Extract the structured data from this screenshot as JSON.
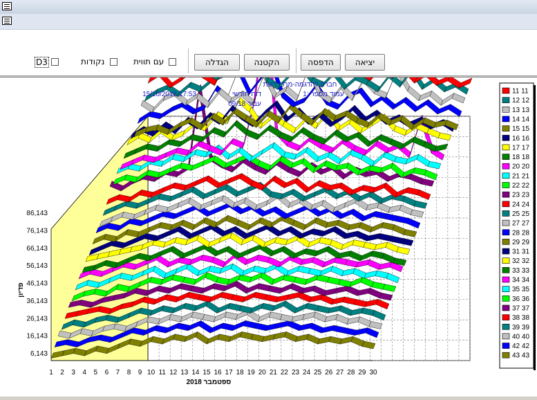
{
  "toolbar": {
    "exit_label": "יציאה",
    "print_label": "הדפסה",
    "shrink_label": "הקטנה",
    "zoom_label": "הגדלה",
    "d3_label": "D3",
    "points_label": "נקודות",
    "area_label": "עם תווית"
  },
  "header": {
    "company": "חברה להדגמה-מרכז רשת",
    "report": "דוח חודשי",
    "page": "עמוד מספר :1",
    "datetime": "15/10/2018 17:53",
    "period": "עבור  09/18"
  },
  "colors": {
    "wall": "#ffff99",
    "grid": "#808080",
    "axis_text": "#000000",
    "header_text": "#1f1fc8"
  },
  "chart_data": {
    "type": "line",
    "style": "3d-ribbon",
    "xlabel": "ספטמבר 2018",
    "ylabel": "פדיון",
    "x": [
      "1",
      "2",
      "3",
      "4",
      "5",
      "6",
      "7",
      "8",
      "9",
      "10",
      "11",
      "12",
      "13",
      "14",
      "15",
      "16",
      "17",
      "18",
      "19",
      "20",
      "21",
      "22",
      "23",
      "24",
      "25",
      "26",
      "27",
      "28",
      "29",
      "30"
    ],
    "y_ticks": [
      "6,143",
      "16,143",
      "26,143",
      "36,143",
      "46,143",
      "56,143",
      "66,143",
      "76,143",
      "86,143"
    ],
    "ylim": [
      6143,
      86143
    ],
    "legend_position": "right",
    "series": [
      {
        "name": "11 11",
        "color": "#ff0000",
        "values": [
          14000,
          17000,
          12000,
          15000,
          19000,
          16000,
          13000,
          22000,
          18000,
          24000,
          21000,
          17000,
          26000,
          30000,
          27000,
          23000,
          19000,
          17000,
          22000,
          18000,
          15000,
          20000,
          16000,
          19000,
          14000,
          17000,
          13000,
          15000,
          12000,
          14000
        ]
      },
      {
        "name": "12 12",
        "color": "#008080",
        "values": [
          10000,
          13000,
          15000,
          12000,
          16000,
          14000,
          18000,
          20000,
          60000,
          79000,
          33000,
          18000,
          15000,
          20000,
          24000,
          18000,
          16000,
          21000,
          15000,
          19000,
          17000,
          14000,
          20000,
          16000,
          22000,
          15000,
          18000,
          14000,
          16000,
          13000
        ]
      },
      {
        "name": "13 13",
        "color": "#c0c0c0",
        "values": [
          12000,
          9000,
          14000,
          16000,
          12000,
          15000,
          11000,
          17000,
          13000,
          16000,
          12000,
          24000,
          15000,
          18000,
          14000,
          27000,
          16000,
          13000,
          19000,
          14000,
          22000,
          17000,
          15000,
          26000,
          18000,
          14000,
          16000,
          12000,
          15000,
          13000
        ]
      },
      {
        "name": "14 14",
        "color": "#0000ff",
        "values": [
          8000,
          11000,
          10000,
          13000,
          15000,
          12000,
          14000,
          22000,
          18000,
          30000,
          20000,
          26000,
          32000,
          19000,
          15000,
          17000,
          23000,
          16000,
          14000,
          19000,
          21000,
          15000,
          18000,
          14000,
          17000,
          13000,
          16000,
          12000,
          14000,
          11000
        ]
      },
      {
        "name": "15 15",
        "color": "#808000",
        "values": [
          6000,
          8000,
          9000,
          7000,
          10000,
          12000,
          9000,
          14000,
          11000,
          16000,
          13000,
          10000,
          15000,
          12000,
          18000,
          14000,
          11000,
          16000,
          13000,
          15000,
          12000,
          10000,
          14000,
          11000,
          13000,
          9000,
          12000,
          10000,
          11000,
          9000
        ]
      },
      {
        "name": "16 16",
        "color": "#000080",
        "values": [
          9000,
          12000,
          10000,
          14000,
          11000,
          16000,
          13000,
          18000,
          15000,
          21000,
          17000,
          14000,
          19000,
          23000,
          16000,
          20000,
          15000,
          18000,
          14000,
          17000,
          21000,
          16000,
          19000,
          15000,
          17000,
          14000,
          16000,
          13000,
          15000,
          12000
        ]
      },
      {
        "name": "17 17",
        "color": "#ffff00",
        "values": [
          10000,
          13000,
          11000,
          15000,
          12000,
          14000,
          18000,
          16000,
          22000,
          19000,
          28000,
          24000,
          17000,
          21000,
          18000,
          15000,
          20000,
          17000,
          23000,
          16000,
          19000,
          15000,
          18000,
          21000,
          16000,
          14000,
          17000,
          15000,
          13000,
          12000
        ]
      },
      {
        "name": "18 18",
        "color": "#008000",
        "values": [
          8000,
          10000,
          12000,
          11000,
          14000,
          13000,
          16000,
          15000,
          19000,
          17000,
          22000,
          18000,
          16000,
          20000,
          17000,
          15000,
          19000,
          16000,
          14000,
          18000,
          15000,
          17000,
          13000,
          16000,
          14000,
          12000,
          15000,
          13000,
          11000,
          12000
        ]
      },
      {
        "name": "20 20",
        "color": "#ff00ff",
        "values": [
          7000,
          9000,
          11000,
          10000,
          12000,
          14000,
          13000,
          17000,
          15000,
          13000,
          18000,
          16000,
          35000,
          74000,
          22000,
          17000,
          15000,
          19000,
          16000,
          14000,
          18000,
          15000,
          13000,
          17000,
          14000,
          16000,
          12000,
          28000,
          14000,
          11000
        ]
      },
      {
        "name": "21 21",
        "color": "#00ffff",
        "values": [
          9000,
          11000,
          10000,
          13000,
          12000,
          15000,
          14000,
          17000,
          16000,
          19000,
          15000,
          18000,
          14000,
          17000,
          20000,
          16000,
          15000,
          18000,
          14000,
          16000,
          13000,
          17000,
          15000,
          12000,
          16000,
          14000,
          13000,
          15000,
          12000,
          11000
        ]
      },
      {
        "name": "22 22",
        "color": "#00ff00",
        "values": [
          8000,
          10000,
          9000,
          12000,
          11000,
          13000,
          15000,
          14000,
          16000,
          18000,
          15000,
          17000,
          19000,
          16000,
          14000,
          18000,
          15000,
          17000,
          13000,
          16000,
          14000,
          15000,
          12000,
          14000,
          13000,
          15000,
          11000,
          13000,
          12000,
          10000
        ]
      },
      {
        "name": "23 23",
        "color": "#800080",
        "values": [
          11000,
          9000,
          12000,
          14000,
          13000,
          16000,
          15000,
          18000,
          52000,
          22000,
          19000,
          17000,
          21000,
          18000,
          16000,
          20000,
          17000,
          15000,
          19000,
          16000,
          18000,
          14000,
          17000,
          15000,
          16000,
          13000,
          15000,
          14000,
          12000,
          11000
        ]
      },
      {
        "name": "24 24",
        "color": "#ff0000",
        "values": [
          7000,
          9000,
          8000,
          11000,
          10000,
          12000,
          14000,
          13000,
          15000,
          17000,
          14000,
          16000,
          18000,
          15000,
          13000,
          17000,
          14000,
          16000,
          12000,
          15000,
          13000,
          14000,
          11000,
          13000,
          12000,
          14000,
          10000,
          12000,
          11000,
          9000
        ]
      },
      {
        "name": "25 25",
        "color": "#008080",
        "values": [
          6000,
          8000,
          10000,
          9000,
          11000,
          13000,
          12000,
          14000,
          16000,
          13000,
          15000,
          17000,
          14000,
          16000,
          18000,
          14000,
          13000,
          15000,
          12000,
          14000,
          16000,
          13000,
          15000,
          12000,
          14000,
          11000,
          13000,
          12000,
          10000,
          9000
        ]
      },
      {
        "name": "27 27",
        "color": "#c0c0c0",
        "values": [
          5000,
          7000,
          9000,
          8000,
          10000,
          12000,
          11000,
          13000,
          15000,
          12000,
          14000,
          16000,
          13000,
          15000,
          12000,
          14000,
          17000,
          13000,
          15000,
          12000,
          14000,
          11000,
          13000,
          15000,
          12000,
          13000,
          11000,
          12000,
          10000,
          9000
        ]
      },
      {
        "name": "28 28",
        "color": "#0000ff",
        "values": [
          6000,
          8000,
          7000,
          10000,
          9000,
          11000,
          13000,
          12000,
          14000,
          16000,
          13000,
          15000,
          17000,
          14000,
          16000,
          13000,
          15000,
          12000,
          14000,
          16000,
          13000,
          15000,
          12000,
          14000,
          11000,
          13000,
          12000,
          11000,
          10000,
          8000
        ]
      },
      {
        "name": "29 29",
        "color": "#808000",
        "values": [
          5000,
          7000,
          6000,
          9000,
          8000,
          10000,
          12000,
          11000,
          13000,
          11000,
          14000,
          12000,
          15000,
          13000,
          11000,
          14000,
          12000,
          15000,
          13000,
          11000,
          14000,
          12000,
          13000,
          11000,
          12000,
          10000,
          12000,
          11000,
          9000,
          8000
        ]
      },
      {
        "name": "31 31",
        "color": "#000080",
        "values": [
          4000,
          6000,
          8000,
          7000,
          9000,
          11000,
          10000,
          12000,
          14000,
          11000,
          13000,
          15000,
          12000,
          14000,
          11000,
          13000,
          15000,
          12000,
          14000,
          11000,
          13000,
          12000,
          14000,
          11000,
          12000,
          10000,
          11000,
          10000,
          9000,
          8000
        ]
      },
      {
        "name": "32 32",
        "color": "#ffff00",
        "values": [
          5000,
          6000,
          7000,
          8000,
          9000,
          10000,
          12000,
          11000,
          13000,
          12000,
          14000,
          11000,
          13000,
          15000,
          12000,
          14000,
          11000,
          13000,
          12000,
          14000,
          11000,
          13000,
          12000,
          10000,
          12000,
          11000,
          10000,
          11000,
          9000,
          8000
        ]
      },
      {
        "name": "33 33",
        "color": "#008000",
        "values": [
          4000,
          5000,
          7000,
          6000,
          8000,
          10000,
          9000,
          11000,
          13000,
          10000,
          12000,
          14000,
          11000,
          13000,
          10000,
          12000,
          14000,
          11000,
          13000,
          10000,
          12000,
          11000,
          13000,
          10000,
          11000,
          9000,
          11000,
          10000,
          8000,
          7000
        ]
      },
      {
        "name": "34 34",
        "color": "#ff00ff",
        "values": [
          5000,
          7000,
          6000,
          8000,
          10000,
          9000,
          11000,
          13000,
          10000,
          12000,
          11000,
          13000,
          12000,
          10000,
          14000,
          11000,
          13000,
          12000,
          10000,
          13000,
          11000,
          12000,
          10000,
          12000,
          11000,
          10000,
          11000,
          9000,
          10000,
          8000
        ]
      },
      {
        "name": "35 35",
        "color": "#00ffff",
        "values": [
          4000,
          6000,
          5000,
          7000,
          9000,
          8000,
          10000,
          12000,
          9000,
          11000,
          13000,
          10000,
          12000,
          11000,
          13000,
          10000,
          12000,
          11000,
          13000,
          10000,
          12000,
          11000,
          10000,
          12000,
          10000,
          11000,
          9000,
          10000,
          9000,
          7000
        ]
      },
      {
        "name": "36 36",
        "color": "#00ff00",
        "values": [
          3000,
          5000,
          6000,
          5000,
          8000,
          7000,
          9000,
          11000,
          10000,
          12000,
          11000,
          10000,
          13000,
          11000,
          10000,
          12000,
          11000,
          13000,
          10000,
          12000,
          11000,
          10000,
          12000,
          11000,
          10000,
          9000,
          11000,
          9000,
          8000,
          7000
        ]
      },
      {
        "name": "37 37",
        "color": "#800080",
        "values": [
          4000,
          5000,
          4000,
          6000,
          7000,
          8000,
          10000,
          9000,
          11000,
          10000,
          12000,
          11000,
          10000,
          12000,
          11000,
          13000,
          10000,
          12000,
          11000,
          10000,
          12000,
          10000,
          11000,
          9000,
          10000,
          11000,
          9000,
          10000,
          8000,
          7000
        ]
      },
      {
        "name": "38 38",
        "color": "#ff0000",
        "values": [
          3000,
          4000,
          5000,
          6000,
          5000,
          7000,
          8000,
          10000,
          9000,
          11000,
          10000,
          12000,
          11000,
          10000,
          12000,
          11000,
          10000,
          12000,
          11000,
          10000,
          11000,
          12000,
          10000,
          11000,
          9000,
          10000,
          9000,
          8000,
          9000,
          7000
        ]
      },
      {
        "name": "39 39",
        "color": "#008080",
        "values": [
          2000,
          4000,
          3000,
          5000,
          6000,
          5000,
          7000,
          9000,
          8000,
          10000,
          9000,
          11000,
          10000,
          12000,
          9000,
          11000,
          10000,
          9000,
          11000,
          10000,
          12000,
          9000,
          11000,
          10000,
          9000,
          10000,
          8000,
          9000,
          8000,
          6000
        ]
      },
      {
        "name": "40 40",
        "color": "#c0c0c0",
        "values": [
          3000,
          2000,
          4000,
          3000,
          5000,
          6000,
          5000,
          7000,
          9000,
          8000,
          10000,
          9000,
          11000,
          10000,
          9000,
          11000,
          10000,
          12000,
          9000,
          11000,
          10000,
          9000,
          10000,
          11000,
          9000,
          10000,
          8000,
          9000,
          7000,
          6000
        ]
      },
      {
        "name": "42 42",
        "color": "#0000ff",
        "values": [
          2000,
          3000,
          2000,
          4000,
          5000,
          4000,
          6000,
          8000,
          7000,
          9000,
          8000,
          10000,
          9000,
          11000,
          8000,
          10000,
          9000,
          11000,
          10000,
          9000,
          10000,
          11000,
          9000,
          10000,
          8000,
          9000,
          8000,
          7000,
          8000,
          6000
        ]
      },
      {
        "name": "43 43",
        "color": "#808000",
        "values": [
          1000,
          2000,
          3000,
          2000,
          4000,
          3000,
          5000,
          7000,
          6000,
          8000,
          7000,
          9000,
          8000,
          10000,
          7000,
          9000,
          8000,
          10000,
          9000,
          8000,
          9000,
          10000,
          8000,
          9000,
          7000,
          8000,
          7000,
          8000,
          6000,
          5000
        ]
      }
    ]
  }
}
